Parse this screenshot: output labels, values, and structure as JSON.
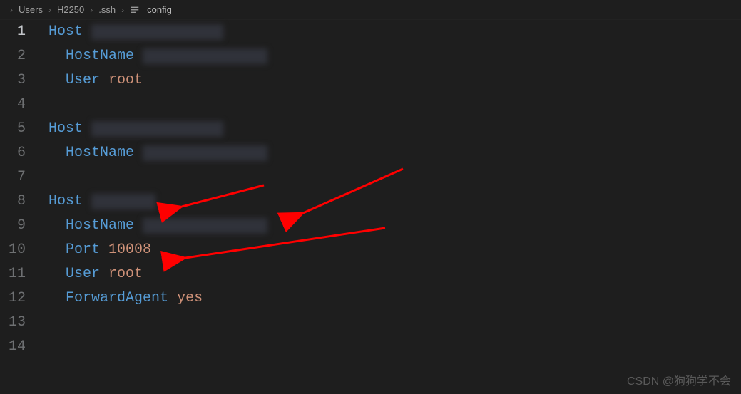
{
  "breadcrumb": {
    "parts": [
      "Users",
      "H2250",
      ".ssh",
      "config"
    ]
  },
  "lines": [
    {
      "num": 1,
      "indent": 0,
      "key": "Host",
      "value_redacted": true,
      "value": null,
      "active": true
    },
    {
      "num": 2,
      "indent": 1,
      "key": "HostName",
      "value_redacted": true,
      "value": null,
      "active": false
    },
    {
      "num": 3,
      "indent": 1,
      "key": "User",
      "value_redacted": false,
      "value": "root",
      "active": false
    },
    {
      "num": 4,
      "indent": 0,
      "key": null,
      "value_redacted": false,
      "value": null,
      "active": false
    },
    {
      "num": 5,
      "indent": 0,
      "key": "Host",
      "value_redacted": true,
      "value": null,
      "active": false
    },
    {
      "num": 6,
      "indent": 1,
      "key": "HostName",
      "value_redacted": true,
      "value": null,
      "active": false
    },
    {
      "num": 7,
      "indent": 0,
      "key": null,
      "value_redacted": false,
      "value": null,
      "active": false
    },
    {
      "num": 8,
      "indent": 0,
      "key": "Host",
      "value_redacted": true,
      "value": null,
      "active": false
    },
    {
      "num": 9,
      "indent": 1,
      "key": "HostName",
      "value_redacted": true,
      "value": null,
      "active": false
    },
    {
      "num": 10,
      "indent": 1,
      "key": "Port",
      "value_redacted": false,
      "value": "10008",
      "active": false
    },
    {
      "num": 11,
      "indent": 1,
      "key": "User",
      "value_redacted": false,
      "value": "root",
      "active": false
    },
    {
      "num": 12,
      "indent": 1,
      "key": "ForwardAgent",
      "value_redacted": false,
      "value": "yes",
      "active": false
    },
    {
      "num": 13,
      "indent": 0,
      "key": null,
      "value_redacted": false,
      "value": null,
      "active": false
    },
    {
      "num": 14,
      "indent": 0,
      "key": null,
      "value_redacted": false,
      "value": null,
      "active": false
    }
  ],
  "watermark": "CSDN @狗狗学不会"
}
